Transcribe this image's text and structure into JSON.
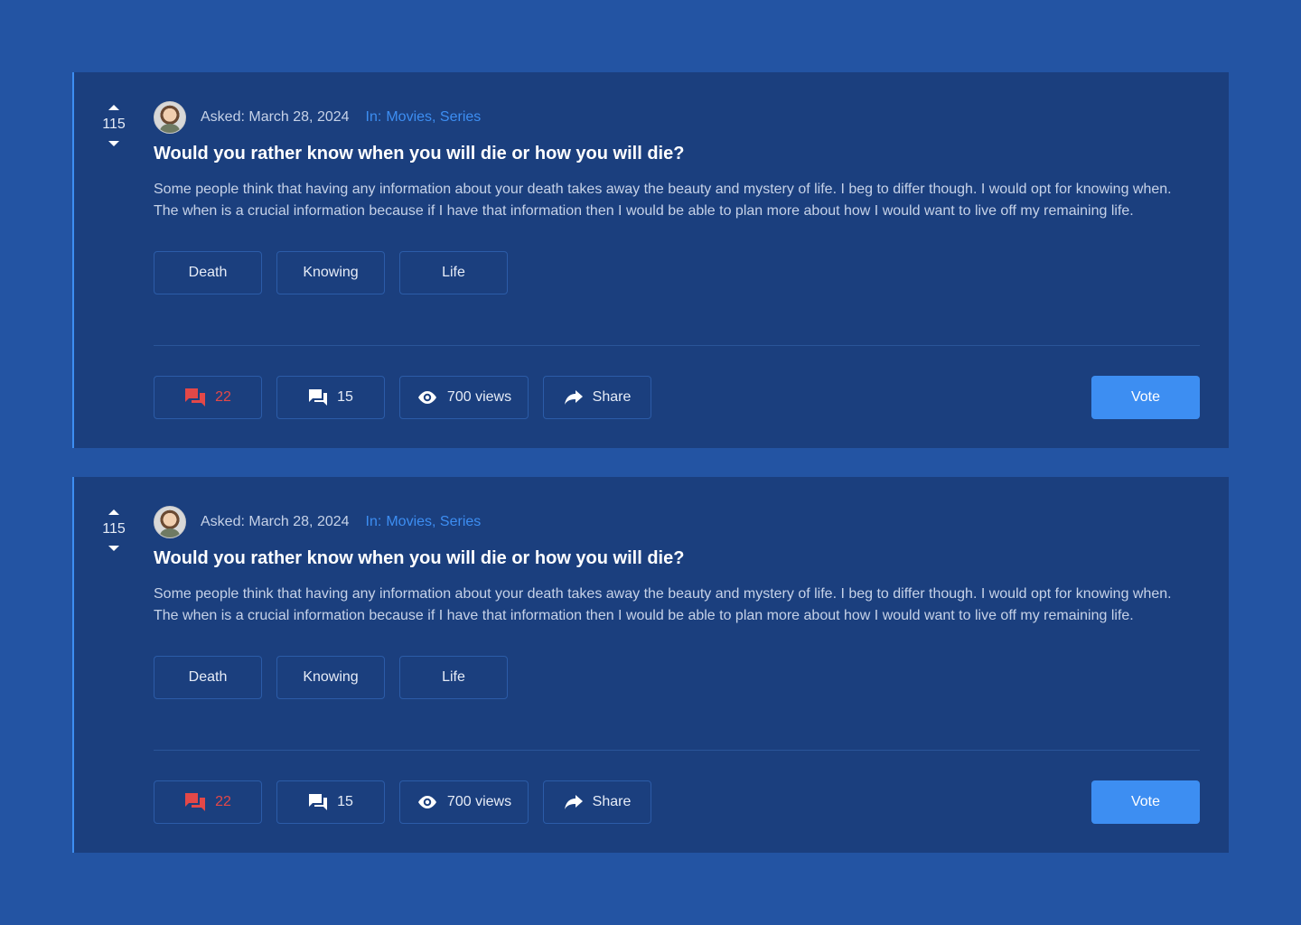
{
  "colors": {
    "page_bg": "#2354a3",
    "card_bg": "#1b3f7e",
    "accent": "#3d8ef2",
    "danger": "#e34848"
  },
  "posts": [
    {
      "votes": "115",
      "asked": "Asked: March 28, 2024",
      "in_label": "In:",
      "categories": "Movies, Series",
      "title": "Would you rather know when you will die or how you will die?",
      "body": "Some people think that having any information about your death takes away the beauty and mystery of life. I beg to differ though. I would opt for knowing when. The when is a crucial information because if I have that information then I would be able to plan more about how I would want to live off my remaining life.",
      "tags": [
        "Death",
        "Knowing",
        "Life"
      ],
      "reports": "22",
      "comments": "15",
      "views": "700 views",
      "share": "Share",
      "vote_label": "Vote",
      "icons": {
        "upvote": "caret-up-icon",
        "downvote": "caret-down-icon",
        "reports": "flag-chat-icon",
        "comments": "chat-icon",
        "views": "eye-icon",
        "share": "share-arrow-icon"
      }
    },
    {
      "votes": "115",
      "asked": "Asked: March 28, 2024",
      "in_label": "In:",
      "categories": "Movies, Series",
      "title": "Would you rather know when you will die or how you will die?",
      "body": "Some people think that having any information about your death takes away the beauty and mystery of life. I beg to differ though. I would opt for knowing when. The when is a crucial information because if I have that information then I would be able to plan more about how I would want to live off my remaining life.",
      "tags": [
        "Death",
        "Knowing",
        "Life"
      ],
      "reports": "22",
      "comments": "15",
      "views": "700 views",
      "share": "Share",
      "vote_label": "Vote",
      "icons": {
        "upvote": "caret-up-icon",
        "downvote": "caret-down-icon",
        "reports": "flag-chat-icon",
        "comments": "chat-icon",
        "views": "eye-icon",
        "share": "share-arrow-icon"
      }
    }
  ]
}
